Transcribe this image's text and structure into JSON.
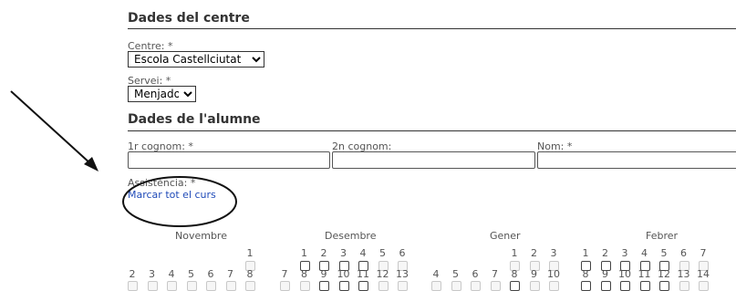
{
  "section_centre": {
    "title": "Dades del centre",
    "centre_label": "Centre: *",
    "centre_value": "Escola Castellciutat",
    "servei_label": "Servei: *",
    "servei_value": "Menjador"
  },
  "section_alumne": {
    "title": "Dades de l'alumne",
    "cognom1_label": "1r cognom: *",
    "cognom2_label": "2n cognom:",
    "nom_label": "Nom: *",
    "assistencia_label": "Assistència: *",
    "marcar_link": "Marcar tot el curs"
  },
  "calendar": {
    "months": [
      "Novembre",
      "Desembre",
      "Gener",
      "Febrer"
    ],
    "row1": {
      "Novembre": [
        {
          "d": "1",
          "enabled": false
        }
      ],
      "Desembre": [
        {
          "d": "1",
          "enabled": true
        },
        {
          "d": "2",
          "enabled": true
        },
        {
          "d": "3",
          "enabled": true
        },
        {
          "d": "4",
          "enabled": true
        },
        {
          "d": "5",
          "enabled": false
        },
        {
          "d": "6",
          "enabled": false
        }
      ],
      "Gener": [
        {
          "d": "1",
          "enabled": false
        },
        {
          "d": "2",
          "enabled": false
        },
        {
          "d": "3",
          "enabled": false
        }
      ],
      "Febrer": [
        {
          "d": "1",
          "enabled": true
        },
        {
          "d": "2",
          "enabled": true
        },
        {
          "d": "3",
          "enabled": true
        },
        {
          "d": "4",
          "enabled": true
        },
        {
          "d": "5",
          "enabled": true
        },
        {
          "d": "6",
          "enabled": false
        },
        {
          "d": "7",
          "enabled": false
        }
      ]
    },
    "row2": {
      "Novembre": [
        {
          "d": "2",
          "enabled": false
        },
        {
          "d": "3",
          "enabled": false
        },
        {
          "d": "4",
          "enabled": false
        },
        {
          "d": "5",
          "enabled": false
        },
        {
          "d": "6",
          "enabled": false
        },
        {
          "d": "7",
          "enabled": false
        },
        {
          "d": "8",
          "enabled": false
        }
      ],
      "Desembre": [
        {
          "d": "7",
          "enabled": false
        },
        {
          "d": "8",
          "enabled": false
        },
        {
          "d": "9",
          "enabled": true
        },
        {
          "d": "10",
          "enabled": true
        },
        {
          "d": "11",
          "enabled": true
        },
        {
          "d": "12",
          "enabled": false
        },
        {
          "d": "13",
          "enabled": false
        }
      ],
      "Gener": [
        {
          "d": "4",
          "enabled": false
        },
        {
          "d": "5",
          "enabled": false
        },
        {
          "d": "6",
          "enabled": false
        },
        {
          "d": "7",
          "enabled": false
        },
        {
          "d": "8",
          "enabled": true
        },
        {
          "d": "9",
          "enabled": false
        },
        {
          "d": "10",
          "enabled": false
        }
      ],
      "Febrer": [
        {
          "d": "8",
          "enabled": true
        },
        {
          "d": "9",
          "enabled": true
        },
        {
          "d": "10",
          "enabled": true
        },
        {
          "d": "11",
          "enabled": true
        },
        {
          "d": "12",
          "enabled": true
        },
        {
          "d": "13",
          "enabled": false
        },
        {
          "d": "14",
          "enabled": false
        }
      ]
    }
  }
}
